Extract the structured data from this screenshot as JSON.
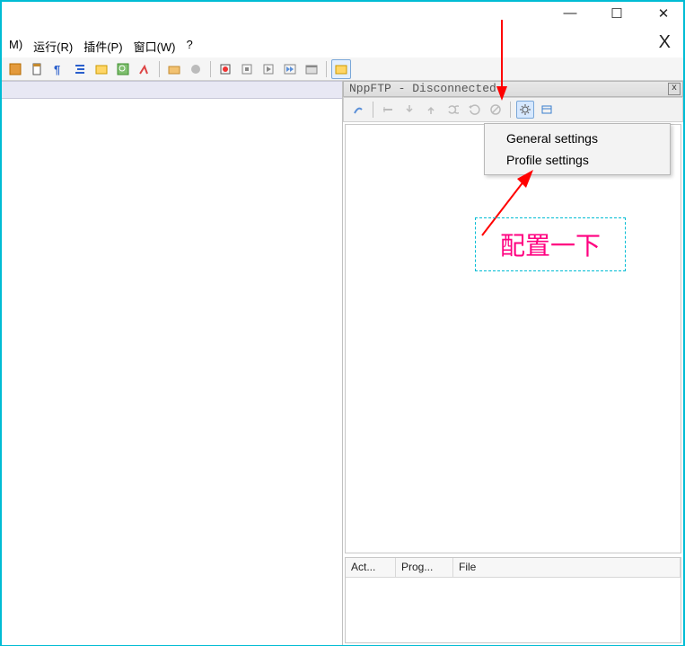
{
  "window": {
    "minimize": "—",
    "maximize": "☐",
    "close": "✕",
    "large_x": "X"
  },
  "menubar": {
    "items": [
      "M)",
      "运行(R)",
      "插件(P)",
      "窗口(W)",
      "?"
    ]
  },
  "toolbar_icons": [
    "cut",
    "paste",
    "paragraph",
    "indent",
    "macro-folder",
    "find-in-files",
    "jump",
    "open-folder",
    "record-stop",
    "macro-record",
    "stop",
    "play",
    "fast-forward",
    "new-window",
    "show-panel"
  ],
  "ftp_panel": {
    "title": "NppFTP - Disconnected",
    "close": "x",
    "toolbar_icons": [
      "connect",
      "disconnect",
      "download",
      "upload",
      "refresh-all",
      "refresh",
      "abort",
      "settings",
      "messages"
    ],
    "status_columns": [
      "Act...",
      "Prog...",
      "File"
    ]
  },
  "settings_menu": {
    "items": [
      "General settings",
      "Profile settings"
    ]
  },
  "annotation": {
    "text": "配置一下"
  },
  "colors": {
    "accent_border": "#00bcd4",
    "annotation_text": "#ff0080",
    "arrow": "#ff0000"
  }
}
